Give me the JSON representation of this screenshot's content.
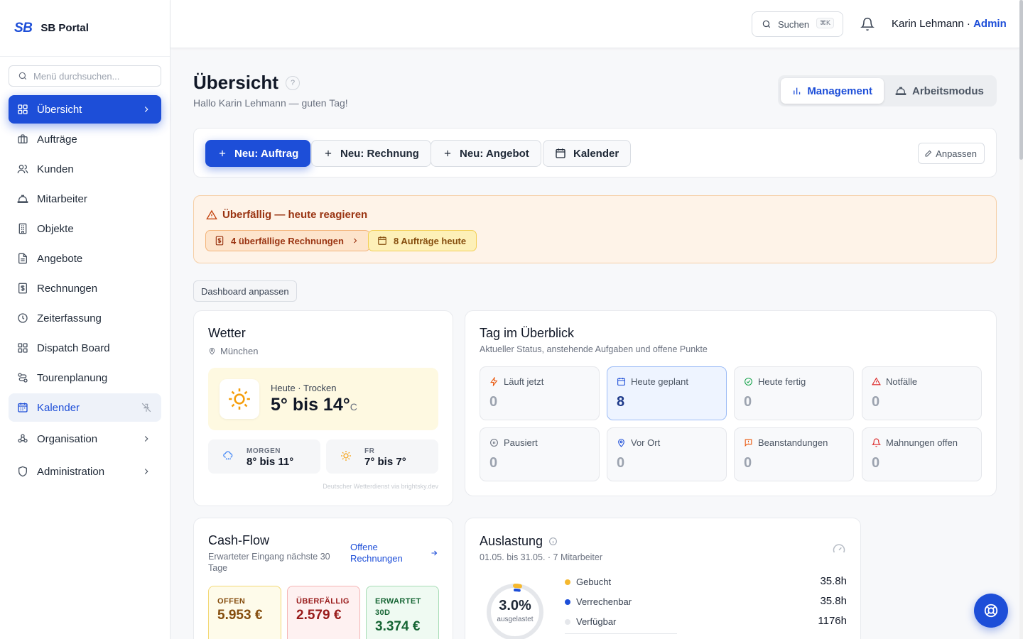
{
  "app": {
    "logo": "SB",
    "name": "SB Portal"
  },
  "sidebar": {
    "search_placeholder": "Menü durchsuchen...",
    "items": [
      {
        "label": "Übersicht",
        "icon": "grid-icon"
      },
      {
        "label": "Aufträge",
        "icon": "briefcase-icon"
      },
      {
        "label": "Kunden",
        "icon": "users-icon"
      },
      {
        "label": "Mitarbeiter",
        "icon": "hardhat-icon"
      },
      {
        "label": "Objekte",
        "icon": "building-icon"
      },
      {
        "label": "Angebote",
        "icon": "file-icon"
      },
      {
        "label": "Rechnungen",
        "icon": "receipt-icon"
      },
      {
        "label": "Zeiterfassung",
        "icon": "clock-icon"
      },
      {
        "label": "Dispatch Board",
        "icon": "grid-icon"
      },
      {
        "label": "Tourenplanung",
        "icon": "route-icon"
      },
      {
        "label": "Kalender",
        "icon": "calendar-icon"
      },
      {
        "label": "Organisation",
        "icon": "org-icon"
      },
      {
        "label": "Administration",
        "icon": "shield-icon"
      }
    ]
  },
  "header": {
    "search_label": "Suchen",
    "search_shortcut": "⌘K",
    "user_name": "Karin Lehmann",
    "separator": " · ",
    "user_role": "Admin"
  },
  "page": {
    "title": "Übersicht",
    "help": "?",
    "greeting": "Hallo Karin Lehmann — guten Tag!",
    "modes": [
      "Management",
      "Arbeitsmodus"
    ]
  },
  "quick_actions": {
    "buttons": [
      "Neu: Auftrag",
      "Neu: Rechnung",
      "Neu: Angebot",
      "Kalender"
    ],
    "customize": "Anpassen"
  },
  "alert": {
    "title": "Überfällig — heute reagieren",
    "chips": [
      "4 überfällige Rechnungen",
      "8 Aufträge heute"
    ]
  },
  "dashboard_customize": "Dashboard anpassen",
  "weather": {
    "title": "Wetter",
    "location": "München",
    "today_label": "Heute · Trocken",
    "today_temp": "5° bis 14°",
    "unit": "C",
    "forecast": [
      {
        "day": "MORGEN",
        "temp": "8° bis 11°",
        "icon": "rain-cloud-icon"
      },
      {
        "day": "FR",
        "temp": "7° bis 7°",
        "icon": "sun-icon"
      }
    ],
    "source": "Deutscher Wetterdienst via brightsky.dev"
  },
  "day_overview": {
    "title": "Tag im Überblick",
    "subtitle": "Aktueller Status, anstehende Aufgaben und offene Punkte",
    "tiles": [
      {
        "label": "Läuft jetzt",
        "value": "0",
        "icon": "bolt-icon"
      },
      {
        "label": "Heute geplant",
        "value": "8",
        "icon": "calendar-icon"
      },
      {
        "label": "Heute fertig",
        "value": "0",
        "icon": "check-circle-icon"
      },
      {
        "label": "Notfälle",
        "value": "0",
        "icon": "warning-icon"
      },
      {
        "label": "Pausiert",
        "value": "0",
        "icon": "pause-icon"
      },
      {
        "label": "Vor Ort",
        "value": "0",
        "icon": "pin-icon"
      },
      {
        "label": "Beanstandungen",
        "value": "0",
        "icon": "message-alert-icon"
      },
      {
        "label": "Mahnungen offen",
        "value": "0",
        "icon": "bell-icon"
      }
    ]
  },
  "cashflow": {
    "title": "Cash-Flow",
    "subtitle": "Erwarteter Eingang nächste 30 Tage",
    "link": "Offene Rechnungen",
    "kpis": [
      {
        "label": "OFFEN",
        "value": "5.953 €"
      },
      {
        "label": "ÜBERFÄLLIG",
        "value": "2.579 €"
      },
      {
        "label": "ERWARTET 30D",
        "value": "3.374 €"
      }
    ]
  },
  "usage": {
    "title": "Auslastung",
    "subtitle": "01.05. bis 31.05. · 7 Mitarbeiter",
    "percent": "3.0%",
    "percent_label": "ausgelastet",
    "utilization": 0.03,
    "legend": [
      {
        "label": "Gebucht",
        "value": "35.8h",
        "color": "#f5b82e"
      },
      {
        "label": "Verrechenbar",
        "value": "35.8h",
        "color": "#1d4ed8"
      },
      {
        "label": "Verfügbar",
        "value": "1176h",
        "color": "#e5e7eb"
      }
    ]
  },
  "colors": {
    "accent": "#1d4ed8",
    "warning_bg": "#fef3e8"
  }
}
